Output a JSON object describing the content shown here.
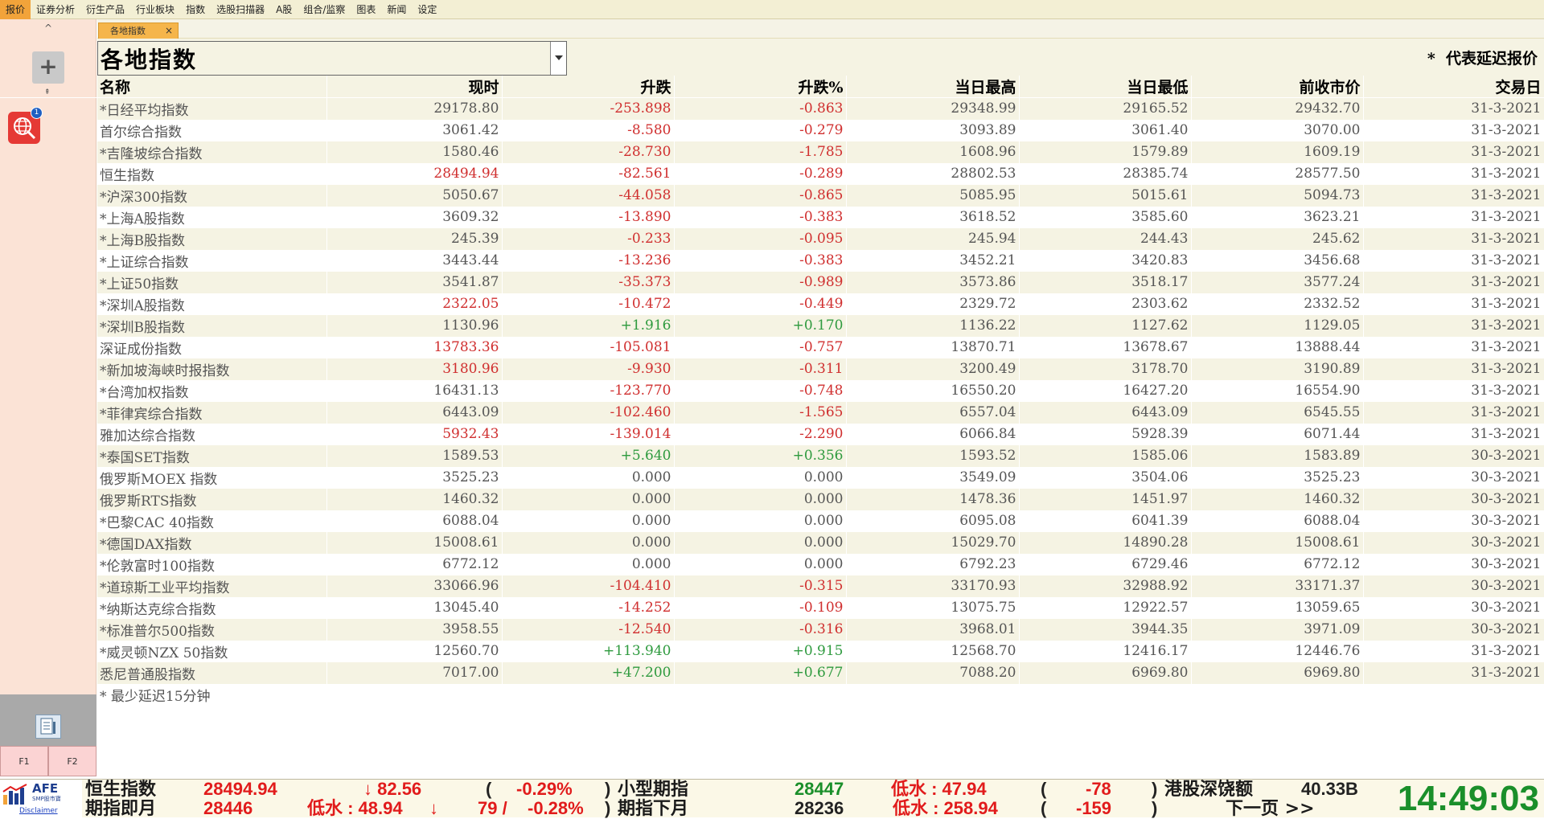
{
  "menu": {
    "items": [
      "报价",
      "证券分析",
      "衍生产品",
      "行业板块",
      "指数",
      "选股扫描器",
      "A股",
      "组合/监察",
      "图表",
      "新闻",
      "设定"
    ],
    "active_index": 0
  },
  "sidebar": {
    "chevron_up": "^",
    "add_label": "+",
    "divider_glyph": "⇞",
    "globe_badge": "1",
    "f1": "F1",
    "f2": "F2"
  },
  "tab": {
    "label": "各地指数",
    "close": "×"
  },
  "header": {
    "select_value": "各地指数",
    "delay_note": "*  代表延迟报价"
  },
  "table": {
    "columns": [
      "名称",
      "现时",
      "升跌",
      "升跌%",
      "当日最高",
      "当日最低",
      "前收市价",
      "交易日"
    ],
    "rows": [
      {
        "name": "*日经平均指数",
        "now": "29178.80",
        "chg": "-253.898",
        "pct": "-0.863",
        "high": "29348.99",
        "low": "29165.52",
        "prev": "29432.70",
        "date": "31-3-2021",
        "dir": "neg",
        "nowdir": ""
      },
      {
        "name": "首尔综合指数",
        "now": "3061.42",
        "chg": "-8.580",
        "pct": "-0.279",
        "high": "3093.89",
        "low": "3061.40",
        "prev": "3070.00",
        "date": "31-3-2021",
        "dir": "neg",
        "nowdir": ""
      },
      {
        "name": "*吉隆坡综合指数",
        "now": "1580.46",
        "chg": "-28.730",
        "pct": "-1.785",
        "high": "1608.96",
        "low": "1579.89",
        "prev": "1609.19",
        "date": "31-3-2021",
        "dir": "neg",
        "nowdir": ""
      },
      {
        "name": "恒生指数",
        "now": "28494.94",
        "chg": "-82.561",
        "pct": "-0.289",
        "high": "28802.53",
        "low": "28385.74",
        "prev": "28577.50",
        "date": "31-3-2021",
        "dir": "neg",
        "nowdir": "neg"
      },
      {
        "name": "*沪深300指数",
        "now": "5050.67",
        "chg": "-44.058",
        "pct": "-0.865",
        "high": "5085.95",
        "low": "5015.61",
        "prev": "5094.73",
        "date": "31-3-2021",
        "dir": "neg",
        "nowdir": ""
      },
      {
        "name": "*上海A股指数",
        "now": "3609.32",
        "chg": "-13.890",
        "pct": "-0.383",
        "high": "3618.52",
        "low": "3585.60",
        "prev": "3623.21",
        "date": "31-3-2021",
        "dir": "neg",
        "nowdir": ""
      },
      {
        "name": "*上海B股指数",
        "now": "245.39",
        "chg": "-0.233",
        "pct": "-0.095",
        "high": "245.94",
        "low": "244.43",
        "prev": "245.62",
        "date": "31-3-2021",
        "dir": "neg",
        "nowdir": ""
      },
      {
        "name": "*上证综合指数",
        "now": "3443.44",
        "chg": "-13.236",
        "pct": "-0.383",
        "high": "3452.21",
        "low": "3420.83",
        "prev": "3456.68",
        "date": "31-3-2021",
        "dir": "neg",
        "nowdir": ""
      },
      {
        "name": "*上证50指数",
        "now": "3541.87",
        "chg": "-35.373",
        "pct": "-0.989",
        "high": "3573.86",
        "low": "3518.17",
        "prev": "3577.24",
        "date": "31-3-2021",
        "dir": "neg",
        "nowdir": ""
      },
      {
        "name": "*深圳A股指数",
        "now": "2322.05",
        "chg": "-10.472",
        "pct": "-0.449",
        "high": "2329.72",
        "low": "2303.62",
        "prev": "2332.52",
        "date": "31-3-2021",
        "dir": "neg",
        "nowdir": "neg"
      },
      {
        "name": "*深圳B股指数",
        "now": "1130.96",
        "chg": "+1.916",
        "pct": "+0.170",
        "high": "1136.22",
        "low": "1127.62",
        "prev": "1129.05",
        "date": "31-3-2021",
        "dir": "pos",
        "nowdir": ""
      },
      {
        "name": "深证成份指数",
        "now": "13783.36",
        "chg": "-105.081",
        "pct": "-0.757",
        "high": "13870.71",
        "low": "13678.67",
        "prev": "13888.44",
        "date": "31-3-2021",
        "dir": "neg",
        "nowdir": "neg"
      },
      {
        "name": "*新加坡海峡时报指数",
        "now": "3180.96",
        "chg": "-9.930",
        "pct": "-0.311",
        "high": "3200.49",
        "low": "3178.70",
        "prev": "3190.89",
        "date": "31-3-2021",
        "dir": "neg",
        "nowdir": "neg"
      },
      {
        "name": "*台湾加权指数",
        "now": "16431.13",
        "chg": "-123.770",
        "pct": "-0.748",
        "high": "16550.20",
        "low": "16427.20",
        "prev": "16554.90",
        "date": "31-3-2021",
        "dir": "neg",
        "nowdir": ""
      },
      {
        "name": "*菲律宾综合指数",
        "now": "6443.09",
        "chg": "-102.460",
        "pct": "-1.565",
        "high": "6557.04",
        "low": "6443.09",
        "prev": "6545.55",
        "date": "31-3-2021",
        "dir": "neg",
        "nowdir": ""
      },
      {
        "name": "雅加达综合指数",
        "now": "5932.43",
        "chg": "-139.014",
        "pct": "-2.290",
        "high": "6066.84",
        "low": "5928.39",
        "prev": "6071.44",
        "date": "31-3-2021",
        "dir": "neg",
        "nowdir": "neg"
      },
      {
        "name": "*泰国SET指数",
        "now": "1589.53",
        "chg": "+5.640",
        "pct": "+0.356",
        "high": "1593.52",
        "low": "1585.06",
        "prev": "1583.89",
        "date": "30-3-2021",
        "dir": "pos",
        "nowdir": ""
      },
      {
        "name": "俄罗斯MOEX 指数",
        "now": "3525.23",
        "chg": "0.000",
        "pct": "0.000",
        "high": "3549.09",
        "low": "3504.06",
        "prev": "3525.23",
        "date": "30-3-2021",
        "dir": "",
        "nowdir": ""
      },
      {
        "name": "俄罗斯RTS指数",
        "now": "1460.32",
        "chg": "0.000",
        "pct": "0.000",
        "high": "1478.36",
        "low": "1451.97",
        "prev": "1460.32",
        "date": "30-3-2021",
        "dir": "",
        "nowdir": ""
      },
      {
        "name": "*巴黎CAC 40指数",
        "now": "6088.04",
        "chg": "0.000",
        "pct": "0.000",
        "high": "6095.08",
        "low": "6041.39",
        "prev": "6088.04",
        "date": "30-3-2021",
        "dir": "",
        "nowdir": ""
      },
      {
        "name": "*德国DAX指数",
        "now": "15008.61",
        "chg": "0.000",
        "pct": "0.000",
        "high": "15029.70",
        "low": "14890.28",
        "prev": "15008.61",
        "date": "30-3-2021",
        "dir": "",
        "nowdir": ""
      },
      {
        "name": "*伦敦富时100指数",
        "now": "6772.12",
        "chg": "0.000",
        "pct": "0.000",
        "high": "6792.23",
        "low": "6729.46",
        "prev": "6772.12",
        "date": "30-3-2021",
        "dir": "",
        "nowdir": ""
      },
      {
        "name": "*道琼斯工业平均指数",
        "now": "33066.96",
        "chg": "-104.410",
        "pct": "-0.315",
        "high": "33170.93",
        "low": "32988.92",
        "prev": "33171.37",
        "date": "30-3-2021",
        "dir": "neg",
        "nowdir": ""
      },
      {
        "name": "*纳斯达克综合指数",
        "now": "13045.40",
        "chg": "-14.252",
        "pct": "-0.109",
        "high": "13075.75",
        "low": "12922.57",
        "prev": "13059.65",
        "date": "30-3-2021",
        "dir": "neg",
        "nowdir": ""
      },
      {
        "name": "*标准普尔500指数",
        "now": "3958.55",
        "chg": "-12.540",
        "pct": "-0.316",
        "high": "3968.01",
        "low": "3944.35",
        "prev": "3971.09",
        "date": "30-3-2021",
        "dir": "neg",
        "nowdir": ""
      },
      {
        "name": "*威灵顿NZX 50指数",
        "now": "12560.70",
        "chg": "+113.940",
        "pct": "+0.915",
        "high": "12568.70",
        "low": "12416.17",
        "prev": "12446.76",
        "date": "31-3-2021",
        "dir": "pos",
        "nowdir": ""
      },
      {
        "name": "悉尼普通股指数",
        "now": "7017.00",
        "chg": "+47.200",
        "pct": "+0.677",
        "high": "7088.20",
        "low": "6969.80",
        "prev": "6969.80",
        "date": "31-3-2021",
        "dir": "pos",
        "nowdir": ""
      }
    ],
    "footnote": "*  最少延迟15分钟"
  },
  "ticker": {
    "logo_text": "AFE",
    "logo_sub": "SMP股市寶",
    "disclaimer": "Disclaimer",
    "hsi_label": "恒生指数",
    "hsi_value": "28494.94",
    "hsi_change": "↓ 82.56",
    "hsi_open_paren": "(",
    "hsi_pct": "-0.29%",
    "hsi_close_paren": ")",
    "mini_label": "小型期指",
    "mini_value": "28447",
    "mini_discount": "低水 : 47.94",
    "mini_open_paren": "(",
    "mini_diff": "-78",
    "mini_close_paren": ")",
    "turnover_label": "港股深饶额",
    "turnover_value": "40.33B",
    "fut_label": "期指即月",
    "fut_value": "28446",
    "fut_discount": "低水 : 48.94",
    "fut_arrow": "↓",
    "fut_change": "79 /",
    "fut_pct": "-0.28%",
    "fut_close_paren": ")",
    "next_label": "期指下月",
    "next_value": "28236",
    "next_discount": "低水 : 258.94",
    "next_open_paren": "(",
    "next_diff": "-159",
    "next_close_paren": ")",
    "next_page": "下一页  >>",
    "clock": "14:49:03"
  },
  "colors": {
    "up": "#2e9a3e",
    "down": "#d02f2f",
    "accent_tab": "#f5b54b",
    "clock": "#1a8f2a"
  }
}
